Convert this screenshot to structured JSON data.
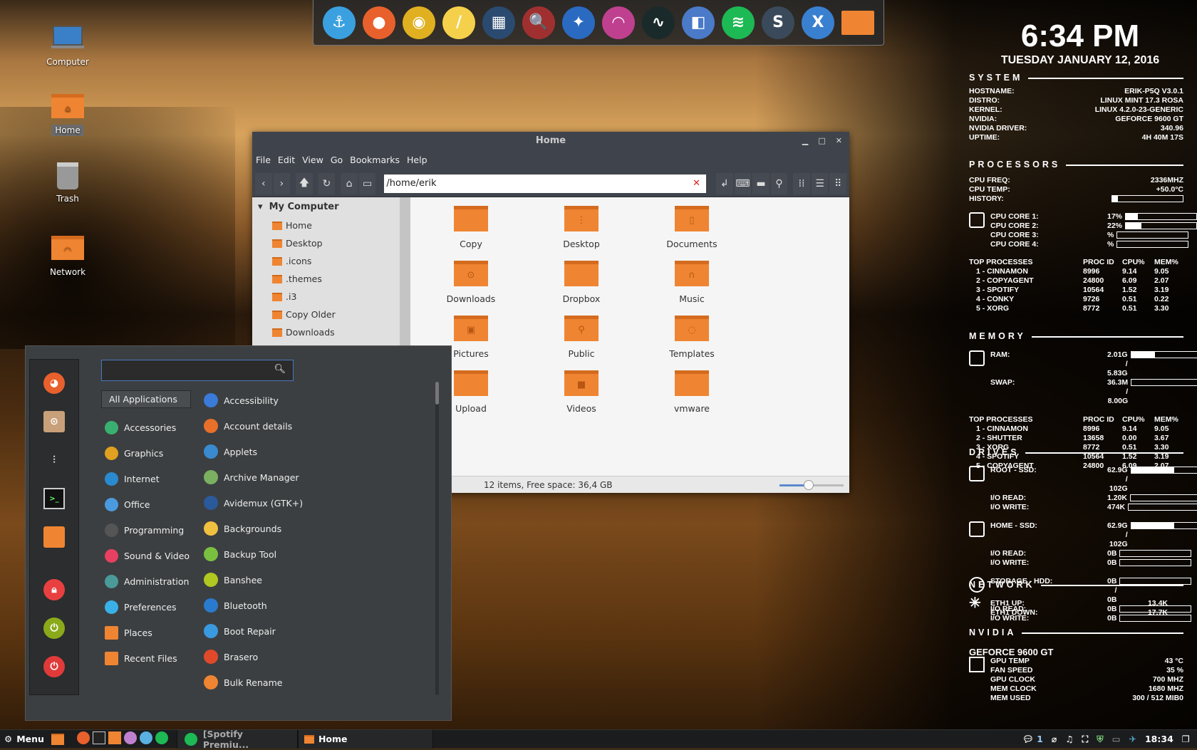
{
  "desktop": {
    "icons": [
      {
        "label": "Computer",
        "icon": "computer-icon"
      },
      {
        "label": "Home",
        "icon": "home-folder-icon",
        "selected": true
      },
      {
        "label": "Trash",
        "icon": "trash-icon"
      },
      {
        "label": "Network",
        "icon": "network-folder-icon"
      }
    ]
  },
  "dock": {
    "items": [
      {
        "name": "anchor",
        "color": "#3aa0e0",
        "glyph": "⚓"
      },
      {
        "name": "firefox",
        "color": "#e8602c",
        "glyph": "●"
      },
      {
        "name": "chrome",
        "color": "#e0b020",
        "glyph": "◉"
      },
      {
        "name": "notes",
        "color": "#f5d04a",
        "glyph": "/"
      },
      {
        "name": "video-editor",
        "color": "#2a4a70",
        "glyph": "▦"
      },
      {
        "name": "image-viewer",
        "color": "#a03030",
        "glyph": "🔍"
      },
      {
        "name": "shutter",
        "color": "#2a6ac0",
        "glyph": "✦"
      },
      {
        "name": "rainbow",
        "color": "#c04090",
        "glyph": "◠"
      },
      {
        "name": "system-monitor",
        "color": "#1a2a2a",
        "glyph": "∿"
      },
      {
        "name": "app",
        "color": "#4a7ac8",
        "glyph": "◧"
      },
      {
        "name": "spotify",
        "color": "#1db954",
        "glyph": "≋"
      },
      {
        "name": "sublime",
        "color": "#3a4a5a",
        "glyph": "S"
      },
      {
        "name": "x-app",
        "color": "#3a80d0",
        "glyph": "X"
      },
      {
        "name": "folder",
        "color": "#ef8532",
        "glyph": ""
      }
    ]
  },
  "clock": {
    "time": "6:34 PM",
    "date": "TUESDAY JANUARY 12, 2016"
  },
  "conky": {
    "system": {
      "title": "SYSTEM",
      "rows": [
        [
          "HOSTNAME:",
          "ERIK-P5Q  V3.0.1"
        ],
        [
          "DISTRO:",
          "LINUX MINT 17.3 ROSA"
        ],
        [
          "KERNEL:",
          "LINUX 4.2.0-23-GENERIC"
        ],
        [
          "NVIDIA:",
          "GEFORCE 9600 GT"
        ],
        [
          "NVIDIA DRIVER:",
          "340.96"
        ],
        [
          "UPTIME:",
          "4H 40M 17S"
        ]
      ]
    },
    "processors": {
      "title": "PROCESSORS",
      "freq_label": "CPU FREQ:",
      "freq": "2336MHZ",
      "temp_label": "CPU TEMP:",
      "temp": "+50.0°C",
      "history_label": "HISTORY:",
      "cores": [
        {
          "label": "CPU CORE 1:",
          "value": "17%",
          "pct": 17
        },
        {
          "label": "CPU CORE 2:",
          "value": "22%",
          "pct": 22
        },
        {
          "label": "CPU CORE 3:",
          "value": "%",
          "pct": 0
        },
        {
          "label": "CPU CORE 4:",
          "value": "%",
          "pct": 0
        }
      ],
      "top_header": [
        "TOP PROCESSES",
        "PROC ID",
        "CPU%",
        "MEM%"
      ],
      "top": [
        [
          "1 - CINNAMON",
          "8996",
          "9.14",
          "9.05"
        ],
        [
          "2 - COPYAGENT",
          "24800",
          "6.09",
          "2.07"
        ],
        [
          "3 - SPOTIFY",
          "10564",
          "1.52",
          "3.19"
        ],
        [
          "4 - CONKY",
          "9726",
          "0.51",
          "0.22"
        ],
        [
          "5 - XORG",
          "8772",
          "0.51",
          "3.30"
        ]
      ]
    },
    "memory": {
      "title": "MEMORY",
      "ram_label": "RAM:",
      "ram": "2.01G / 5.83G",
      "ram_pct": 34,
      "swap_label": "SWAP:",
      "swap": "36.3M / 8.00G",
      "swap_pct": 0,
      "top_header": [
        "TOP PROCESSES",
        "PROC ID",
        "CPU%",
        "MEM%"
      ],
      "top": [
        [
          "1 - CINNAMON",
          "8996",
          "9.14",
          "9.05"
        ],
        [
          "2 - SHUTTER",
          "13658",
          "0.00",
          "3.67"
        ],
        [
          "3 - XORG",
          "8772",
          "0.51",
          "3.30"
        ],
        [
          "4 - SPOTIFY",
          "10564",
          "1.52",
          "3.19"
        ],
        [
          "5 - COPYAGENT",
          "24800",
          "6.09",
          "2.07"
        ]
      ]
    },
    "drives": {
      "title": "DRIVES",
      "groups": [
        {
          "rows": [
            [
              "ROOT - SSD:",
              "62.9G / 102G",
              61
            ],
            [
              "I/O READ:",
              "1.20K",
              0
            ],
            [
              "I/O WRITE:",
              "474K",
              0
            ]
          ]
        },
        {
          "rows": [
            [
              "HOME - SSD:",
              "62.9G / 102G",
              61
            ],
            [
              "I/O READ:",
              "0B",
              0
            ],
            [
              "I/O WRITE:",
              "0B",
              0
            ]
          ]
        },
        {
          "rows": [
            [
              "STORAGE - HDD:",
              "0B / 0B",
              0
            ],
            [
              "I/O READ:",
              "0B",
              0
            ],
            [
              "I/O WRITE:",
              "0B",
              0
            ]
          ]
        }
      ]
    },
    "network": {
      "title": "NETWORK",
      "rows": [
        [
          "ETH1 UP:",
          "13.4K"
        ],
        [
          "ETH1 DOWN:",
          "17.7K"
        ]
      ]
    },
    "nvidia": {
      "title": "NVIDIA",
      "gpu": "GEFORCE 9600 GT",
      "rows": [
        [
          "GPU TEMP",
          "43 °C"
        ],
        [
          "FAN SPEED",
          "35 %"
        ],
        [
          "GPU CLOCK",
          "700 MHZ"
        ],
        [
          "MEM CLOCK",
          "1680 MHZ"
        ],
        [
          "MEM USED",
          "300 / 512 MIB0"
        ]
      ]
    }
  },
  "file_manager": {
    "title": "Home",
    "menu": [
      "File",
      "Edit",
      "View",
      "Go",
      "Bookmarks",
      "Help"
    ],
    "location": "/home/erik",
    "sidebar": {
      "header": "My Computer",
      "items": [
        "Home",
        "Desktop",
        ".icons",
        ".themes",
        ".i3",
        "Copy Older",
        "Downloads"
      ]
    },
    "files": [
      {
        "name": "Copy",
        "glyph": ""
      },
      {
        "name": "Desktop",
        "glyph": "⋮"
      },
      {
        "name": "Documents",
        "glyph": "▯"
      },
      {
        "name": "Downloads",
        "glyph": "⊙"
      },
      {
        "name": "Dropbox",
        "glyph": ""
      },
      {
        "name": "Music",
        "glyph": "∩"
      },
      {
        "name": "Pictures",
        "glyph": "▣"
      },
      {
        "name": "Public",
        "glyph": "⚲"
      },
      {
        "name": "Templates",
        "glyph": "◌"
      },
      {
        "name": "Upload",
        "glyph": ""
      },
      {
        "name": "Videos",
        "glyph": "■"
      },
      {
        "name": "vmware",
        "glyph": ""
      }
    ],
    "status": "12 items, Free space: 36,4 GB",
    "zoom_pct": 45
  },
  "menu": {
    "search_placeholder": "",
    "all_label": "All Applications",
    "favorites": [
      {
        "name": "firefox",
        "color": "#e8602c"
      },
      {
        "name": "package-installer",
        "color": "#c8a07a"
      },
      {
        "name": "system-settings",
        "color": "#2b2d2e"
      },
      {
        "name": "terminal",
        "color": "#111"
      },
      {
        "name": "files",
        "color": "#ef8532"
      },
      {
        "name": "lock-screen",
        "color": "#e84040"
      },
      {
        "name": "logout",
        "color": "#8aaa1a"
      },
      {
        "name": "shutdown",
        "color": "#e03a3a"
      }
    ],
    "categories": [
      {
        "label": "Accessories",
        "color": "#3ab070"
      },
      {
        "label": "Graphics",
        "color": "#e0a020"
      },
      {
        "label": "Internet",
        "color": "#2a8ad0"
      },
      {
        "label": "Office",
        "color": "#4a9ae0"
      },
      {
        "label": "Programming",
        "color": "#555"
      },
      {
        "label": "Sound & Video",
        "color": "#e84060"
      },
      {
        "label": "Administration",
        "color": "#4a9a9a"
      },
      {
        "label": "Preferences",
        "color": "#3ab0e8"
      },
      {
        "label": "Places",
        "color": "#ef8532"
      },
      {
        "label": "Recent Files",
        "color": "#ef8532"
      }
    ],
    "apps": [
      {
        "label": "Accessibility",
        "color": "#3a7ad8"
      },
      {
        "label": "Account details",
        "color": "#e8702a"
      },
      {
        "label": "Applets",
        "color": "#3a8ad0"
      },
      {
        "label": "Archive Manager",
        "color": "#7ab060"
      },
      {
        "label": "Avidemux (GTK+)",
        "color": "#2a5a9a"
      },
      {
        "label": "Backgrounds",
        "color": "#f0c040"
      },
      {
        "label": "Backup Tool",
        "color": "#7ac040"
      },
      {
        "label": "Banshee",
        "color": "#b0c820"
      },
      {
        "label": "Bluetooth",
        "color": "#2a7ad0"
      },
      {
        "label": "Boot Repair",
        "color": "#3a9ae0"
      },
      {
        "label": "Brasero",
        "color": "#e04a2a"
      },
      {
        "label": "Bulk Rename",
        "color": "#ef8532"
      }
    ]
  },
  "taskbar": {
    "menu_label": "Menu",
    "launchers": [
      {
        "name": "firefox",
        "color": "#e8602c"
      },
      {
        "name": "terminal",
        "color": "#222"
      },
      {
        "name": "files",
        "color": "#ef8532"
      },
      {
        "name": "pidgin",
        "color": "#c080d0"
      },
      {
        "name": "dropbox",
        "color": "#5ab0e0"
      },
      {
        "name": "spotify",
        "color": "#1db954"
      }
    ],
    "windows": [
      {
        "label": "[Spotify Premiu...",
        "icon": "spotify-icon"
      },
      {
        "label": "Home",
        "icon": "folder-icon"
      }
    ],
    "tray": {
      "notifications": "1",
      "time": "18:34"
    }
  }
}
